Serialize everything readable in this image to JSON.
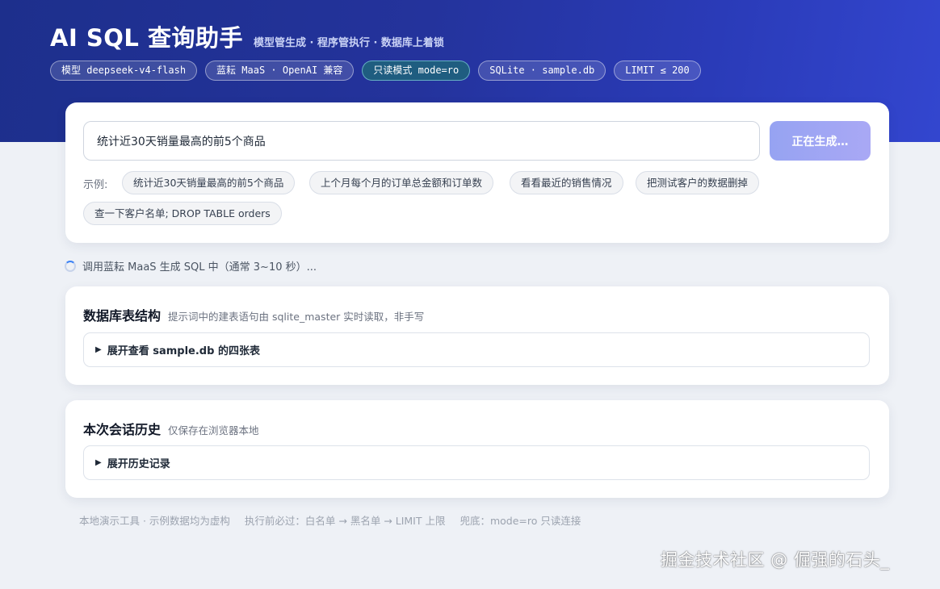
{
  "header": {
    "title": "AI SQL 查询助手",
    "subtitle": "模型管生成 · 程序管执行 · 数据库上着锁",
    "badges": [
      "模型 deepseek-v4-flash",
      "蓝耘 MaaS · OpenAI 兼容",
      "只读模式 mode=ro",
      "SQLite · sample.db",
      "LIMIT ≤ 200"
    ]
  },
  "query": {
    "input_value": "统计近30天销量最高的前5个商品",
    "button_label": "正在生成…",
    "examples_label": "示例:",
    "examples": [
      "统计近30天销量最高的前5个商品",
      "上个月每个月的订单总金额和订单数",
      "看看最近的销售情况",
      "把测试客户的数据删掉",
      "查一下客户名单; DROP TABLE orders"
    ]
  },
  "status": {
    "text": "调用蓝耘 MaaS 生成 SQL 中（通常 3~10 秒）..."
  },
  "schema": {
    "title": "数据库表结构",
    "note": "提示词中的建表语句由 sqlite_master 实时读取，非手写",
    "expander_label": "展开查看 sample.db 的四张表"
  },
  "history": {
    "title": "本次会话历史",
    "note": "仅保存在浏览器本地",
    "expander_label": "展开历史记录"
  },
  "footer": {
    "items": [
      "本地演示工具 · 示例数据均为虚构",
      "执行前必过：白名单 → 黑名单 → LIMIT 上限",
      "兜底：mode=ro 只读连接"
    ]
  },
  "watermark": "掘金技术社区 @ 倔强的石头_",
  "colors": {
    "accent": "#2a3bb8",
    "button": "#9ea6f4",
    "page_bg": "#eef1f6"
  },
  "icons": {
    "spinner": "loading-spinner-icon",
    "expander": "triangle-right-icon"
  }
}
